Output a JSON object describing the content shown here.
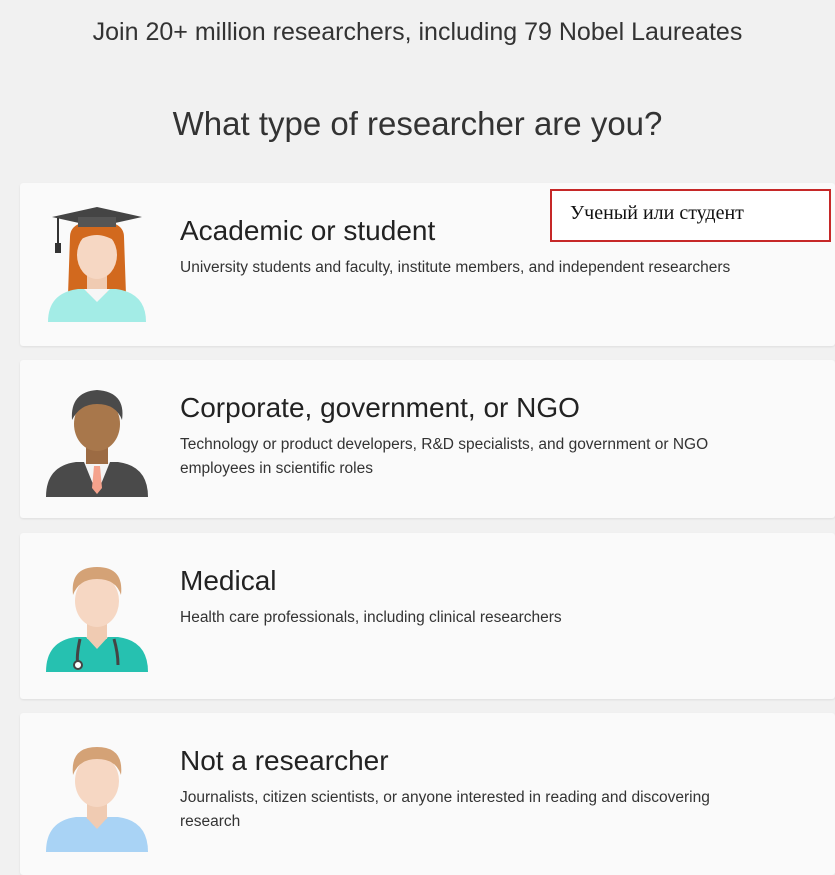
{
  "header": {
    "join_text": "Join 20+ million researchers, including 79 Nobel Laureates",
    "question": "What type of researcher are you?"
  },
  "options": [
    {
      "title": "Academic or student",
      "description": "University students and faculty, institute members, and independent researchers",
      "avatar_icon": "academic-avatar-icon"
    },
    {
      "title": "Corporate, government, or NGO",
      "description": "Technology or product developers, R&D specialists, and government or NGO employees in scientific roles",
      "avatar_icon": "corporate-avatar-icon"
    },
    {
      "title": "Medical",
      "description": "Health care professionals, including clinical researchers",
      "avatar_icon": "medical-avatar-icon"
    },
    {
      "title": "Not a researcher",
      "description": "Journalists, citizen scientists, or anyone interested in reading and discovering research",
      "avatar_icon": "person-avatar-icon"
    }
  ],
  "annotation": {
    "text": "Ученый или студент",
    "border_color": "#c62828"
  },
  "colors": {
    "background": "#f1f1f1",
    "card": "#fafafa",
    "teal": "#26c1b0",
    "light_teal": "#a3ece6",
    "light_blue": "#a9d3f5",
    "dark_gray": "#4a4a4a"
  }
}
